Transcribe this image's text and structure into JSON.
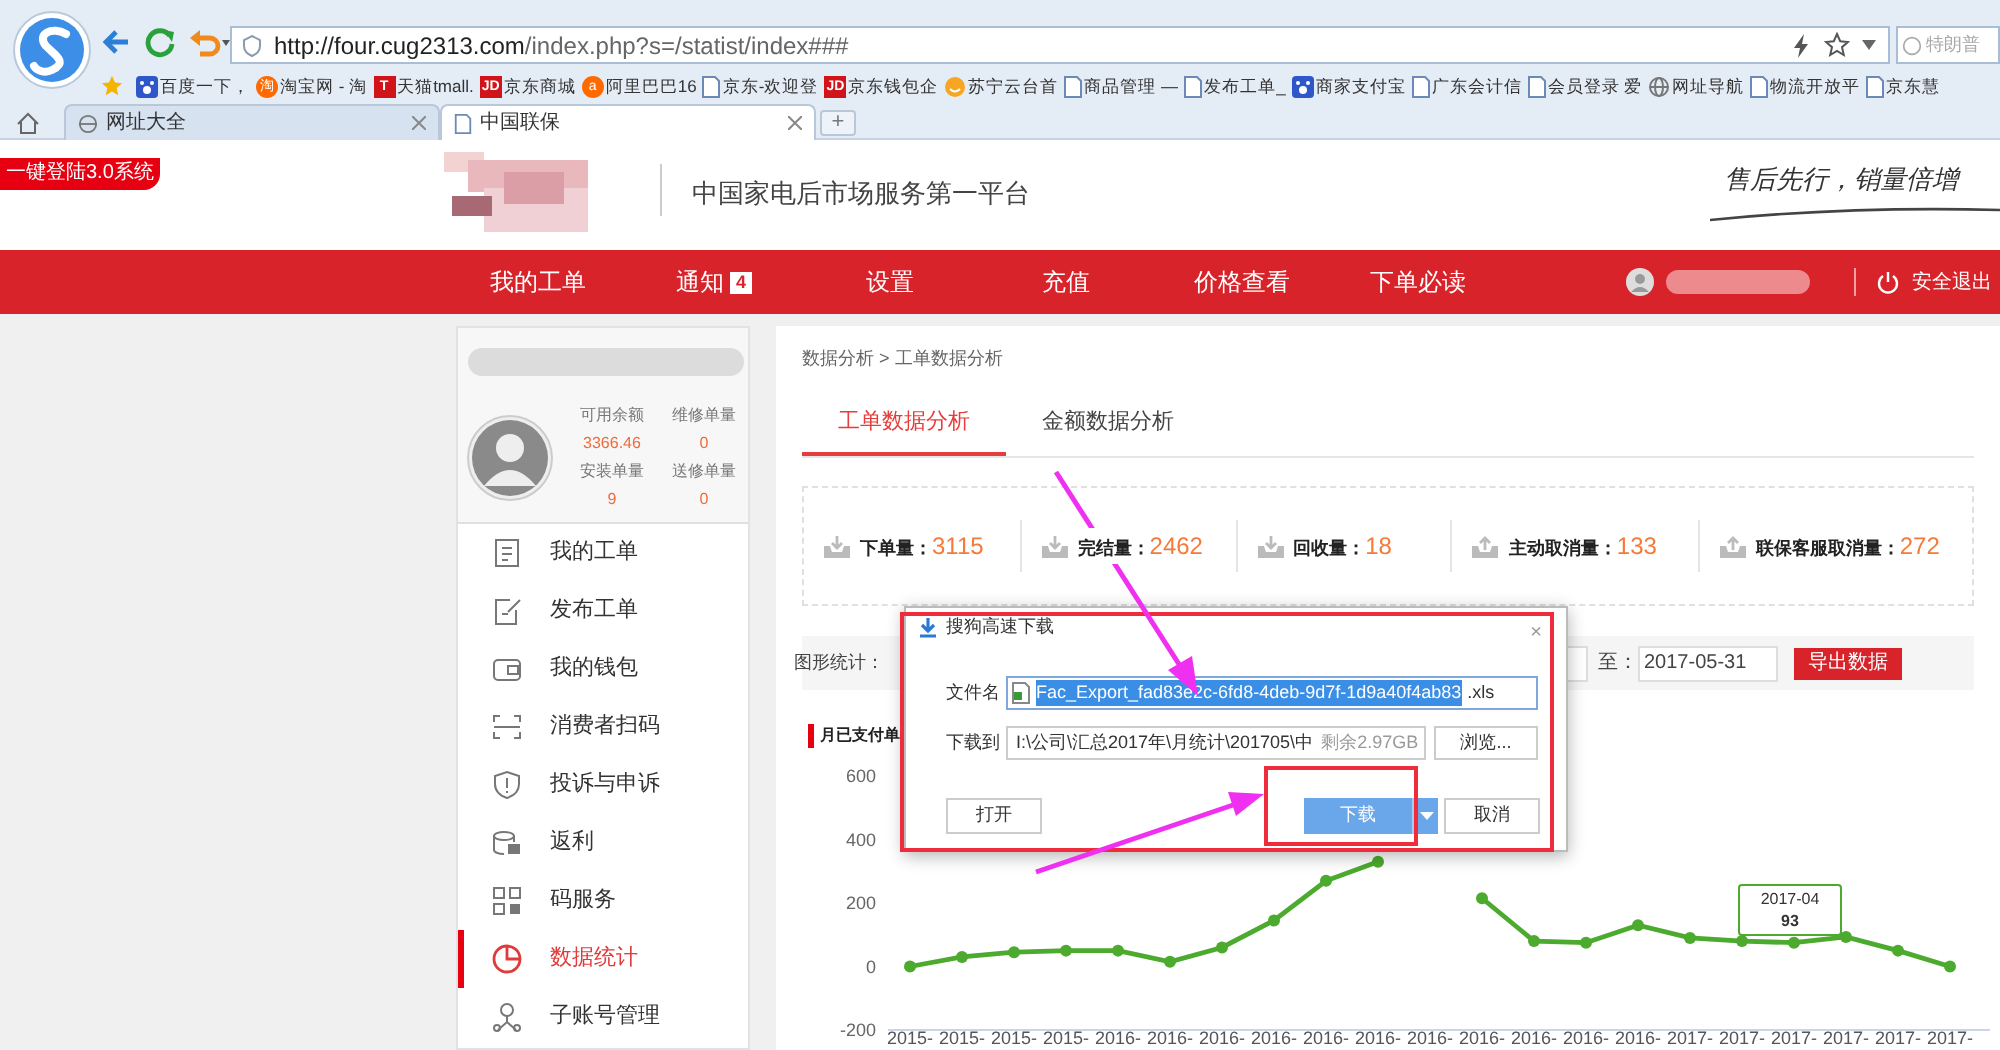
{
  "browser": {
    "url_host": "http://four.cug2313.com",
    "url_path": "/index.php?s=/statist/index###",
    "search_placeholder": "特朗普",
    "bookmarks": [
      {
        "label": "百度一下，",
        "kind": "paw"
      },
      {
        "label": "淘宝网 - 淘",
        "kind": "orange",
        "icon_label": "淘"
      },
      {
        "label": "天猫tmall.",
        "kind": "letter",
        "icon_label": "T"
      },
      {
        "label": "京东商城",
        "kind": "letter",
        "icon_label": "JD"
      },
      {
        "label": "阿里巴巴16",
        "kind": "orange",
        "icon_label": "a"
      },
      {
        "label": "京东-欢迎登",
        "kind": "page"
      },
      {
        "label": "京东钱包企",
        "kind": "letter",
        "icon_label": "JD"
      },
      {
        "label": "苏宁云台首",
        "kind": "smile"
      },
      {
        "label": "商品管理 —",
        "kind": "page"
      },
      {
        "label": "发布工单_",
        "kind": "page"
      },
      {
        "label": "商家支付宝",
        "kind": "paw"
      },
      {
        "label": "广东会计信",
        "kind": "page"
      },
      {
        "label": "会员登录 爱",
        "kind": "page"
      },
      {
        "label": "网址导航",
        "kind": "globe"
      },
      {
        "label": "物流开放平",
        "kind": "page"
      },
      {
        "label": "京东慧",
        "kind": "page"
      }
    ],
    "tabs": [
      {
        "label": "网址大全",
        "selected": false,
        "kind": "globe"
      },
      {
        "label": "中国联保",
        "selected": true,
        "kind": "page"
      }
    ],
    "new_tab": "+"
  },
  "header": {
    "login_tag": "一键登陆3.0系统",
    "platform": "中国家电后市场服务第一平台",
    "slogan": "售后先行，销量倍增"
  },
  "nav": {
    "items": [
      {
        "label": "我的工单"
      },
      {
        "label": "通知",
        "badge": "4"
      },
      {
        "label": "设置"
      },
      {
        "label": "充值"
      },
      {
        "label": "价格查看"
      },
      {
        "label": "下单必读"
      }
    ],
    "logout": "安全退出"
  },
  "profile": {
    "stats": [
      {
        "label": "可用余额",
        "value": "3366.46"
      },
      {
        "label": "维修单量",
        "value": "0"
      },
      {
        "label": "安装单量",
        "value": "9"
      },
      {
        "label": "送修单量",
        "value": "0"
      }
    ]
  },
  "menu": [
    {
      "label": "我的工单",
      "selected": false
    },
    {
      "label": "发布工单",
      "selected": false
    },
    {
      "label": "我的钱包",
      "selected": false
    },
    {
      "label": "消费者扫码",
      "selected": false
    },
    {
      "label": "投诉与申诉",
      "selected": false
    },
    {
      "label": "返利",
      "selected": false
    },
    {
      "label": "码服务",
      "selected": false
    },
    {
      "label": "数据统计",
      "selected": true
    },
    {
      "label": "子账号管理",
      "selected": false
    }
  ],
  "breadcrumb": "数据分析 > 工单数据分析",
  "tabs": [
    {
      "label": "工单数据分析",
      "selected": true
    },
    {
      "label": "金额数据分析",
      "selected": false
    }
  ],
  "stats": [
    {
      "label": "下单量：",
      "value": "3115",
      "kind": "down"
    },
    {
      "label": "完结量：",
      "value": "2462",
      "kind": "down"
    },
    {
      "label": "回收量：",
      "value": "18",
      "kind": "down"
    },
    {
      "label": "主动取消量：",
      "value": "133",
      "kind": "up"
    },
    {
      "label": "联保客服取消量：",
      "value": "272",
      "kind": "up"
    }
  ],
  "filter": {
    "label": "图形统计：",
    "to_label": "至：",
    "end_date": "2017-05-31",
    "export_button": "导出数据"
  },
  "chart": {
    "tooltip": {
      "title": "2017-04",
      "value": "93"
    },
    "chart_data": {
      "type": "line",
      "categories": [
        "2015-",
        "2015-",
        "2015-",
        "2015-",
        "2016-",
        "2016-",
        "2016-",
        "2016-",
        "2016-",
        "2016-",
        "2016-",
        "2016-",
        "2016-",
        "2016-",
        "2016-",
        "2017-",
        "2017-",
        "2017-",
        "2017-",
        "2017-",
        "2017-"
      ],
      "series": [
        {
          "name": "月已支付单",
          "color": "#4caa2e",
          "marker": true,
          "values": [
            0,
            30,
            45,
            50,
            50,
            15,
            60,
            145,
            270,
            330,
            null,
            215,
            80,
            75,
            130,
            90,
            80,
            75,
            93,
            50,
            0
          ]
        }
      ],
      "ylim": [
        -200,
        600
      ],
      "yticks": [
        -200,
        0,
        200,
        400,
        600
      ]
    }
  },
  "dialog": {
    "title": "搜狗高速下载",
    "close": "×",
    "filename_label": "文件名",
    "filename_selected": "Fac_Export_fad83e2c-6fd8-4deb-9d7f-1d9a40f4ab83",
    "filename_ext": ".xls",
    "saveto_label": "下载到",
    "path": "I:\\公司\\汇总2017年\\月统计\\201705\\中",
    "free_space": "剩余2.97GB",
    "browse": "浏览...",
    "open": "打开",
    "download": "下载",
    "cancel": "取消"
  }
}
